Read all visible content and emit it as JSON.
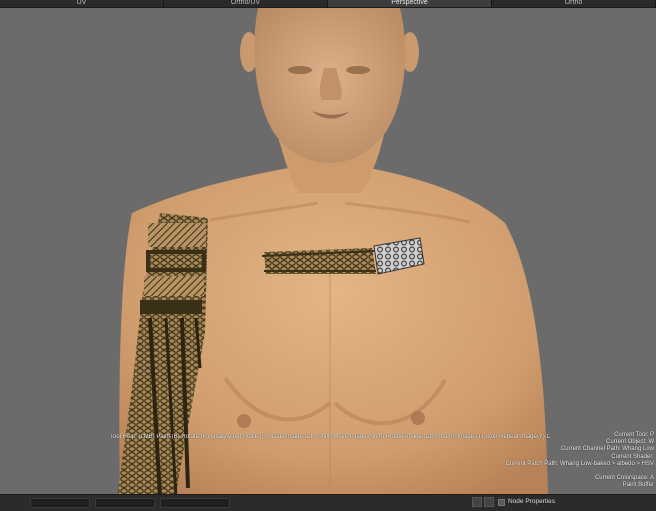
{
  "tabs": [
    {
      "label": "UV",
      "active": false
    },
    {
      "label": "Ortho/UV",
      "active": false
    },
    {
      "label": "Perspective",
      "active": true
    },
    {
      "label": "Ortho",
      "active": false
    }
  ],
  "viewport": {
    "background": "#6b6b6b",
    "skin_color": "#d9a878",
    "tattoo_color": "#3a2f17"
  },
  "tool_help": "Tool Help: (LMB) Paint (B) Rotate (R) Opacity (O) Scale (S) Scale Image (Ctrl-Shift) Move Image (Shift) Rotate Image (Ctrl) Stamp Image (T) Stop Repeat Image(Y) Change Preview",
  "hud_lines": [
    "Current Tool: P",
    "Current Object: W",
    "Current Channel Path: Whang Low",
    "Current Shader:",
    "Current Patch Path: Whang Low-baked > albedo > HSV",
    "",
    "Current Colorspace: A",
    "Paint Buffer"
  ],
  "bottom_bar": {
    "node_properties_label": "Node Properties"
  }
}
